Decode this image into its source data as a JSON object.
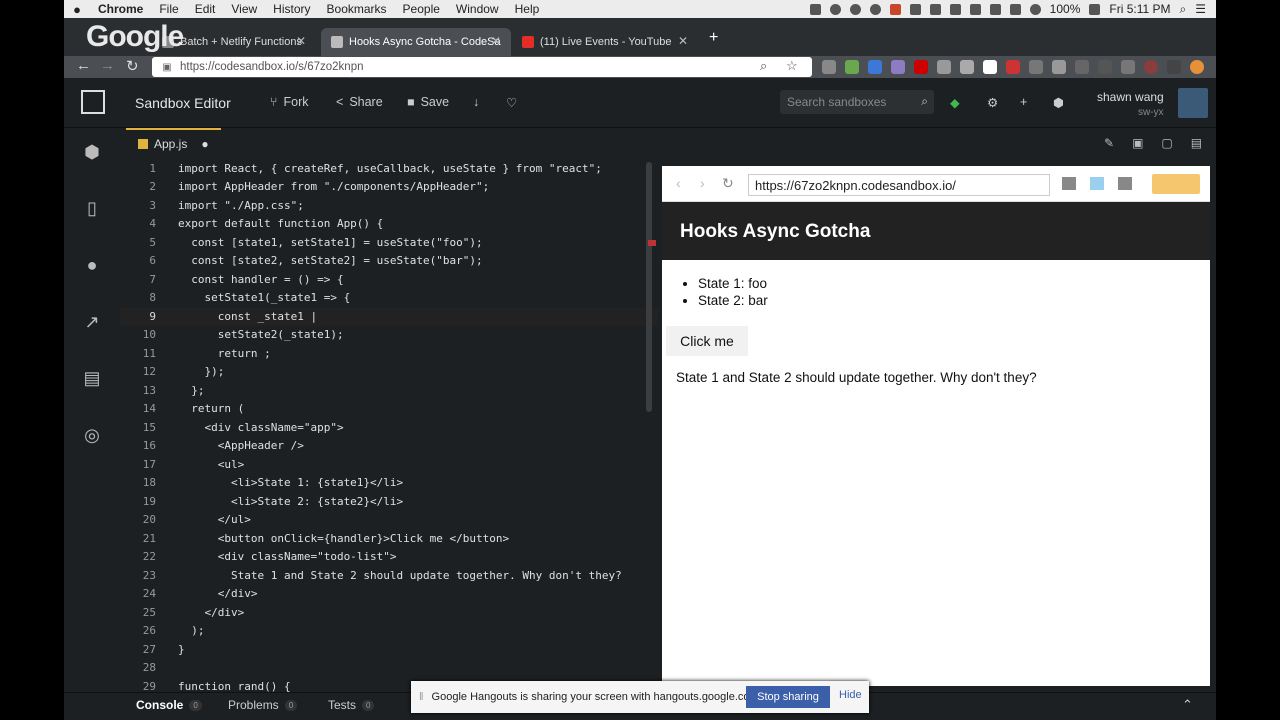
{
  "menubar": {
    "app": "Chrome",
    "items": [
      "File",
      "Edit",
      "View",
      "History",
      "Bookmarks",
      "People",
      "Window",
      "Help"
    ],
    "battery": "100%",
    "clock": "Fri 5:11 PM"
  },
  "overlay_logo": "Google",
  "tabs": [
    {
      "label": "Batch + Netlify Functions"
    },
    {
      "label": "Hooks Async Gotcha - CodeSa"
    },
    {
      "label": "(11) Live Events - YouTube"
    }
  ],
  "address_bar": {
    "url": "https://codesandbox.io/s/67zo2knpn"
  },
  "sandbox": {
    "title": "Sandbox Editor",
    "fork_label": "Fork",
    "share_label": "Share",
    "save_label": "Save",
    "search_placeholder": "Search sandboxes",
    "user_name": "shawn wang",
    "user_handle": "sw-yx"
  },
  "file_tab": {
    "name": "App.js",
    "modified_indicator": "●"
  },
  "editor": {
    "lines": [
      {
        "n": "1",
        "text": "import React, { createRef, useCallback, useState } from \"react\";"
      },
      {
        "n": "2",
        "text": "import AppHeader from \"./components/AppHeader\";"
      },
      {
        "n": "3",
        "text": "import \"./App.css\";"
      },
      {
        "n": "4",
        "text": "export default function App() {"
      },
      {
        "n": "5",
        "text": "  const [state1, setState1] = useState(\"foo\");"
      },
      {
        "n": "6",
        "text": "  const [state2, setState2] = useState(\"bar\");"
      },
      {
        "n": "7",
        "text": "  const handler = () => {"
      },
      {
        "n": "8",
        "text": "    setState1(_state1 => {"
      },
      {
        "n": "9",
        "text": "      const _state1 |"
      },
      {
        "n": "10",
        "text": "      setState2(_state1);"
      },
      {
        "n": "11",
        "text": "      return ;"
      },
      {
        "n": "12",
        "text": "    });"
      },
      {
        "n": "13",
        "text": "  };"
      },
      {
        "n": "14",
        "text": "  return ("
      },
      {
        "n": "15",
        "text": "    <div className=\"app\">"
      },
      {
        "n": "16",
        "text": "      <AppHeader />"
      },
      {
        "n": "17",
        "text": "      <ul>"
      },
      {
        "n": "18",
        "text": "        <li>State 1: {state1}</li>"
      },
      {
        "n": "19",
        "text": "        <li>State 2: {state2}</li>"
      },
      {
        "n": "20",
        "text": "      </ul>"
      },
      {
        "n": "21",
        "text": "      <button onClick={handler}>Click me </button>"
      },
      {
        "n": "22",
        "text": "      <div className=\"todo-list\">"
      },
      {
        "n": "23",
        "text": "        State 1 and State 2 should update together. Why don't they?"
      },
      {
        "n": "24",
        "text": "      </div>"
      },
      {
        "n": "25",
        "text": "    </div>"
      },
      {
        "n": "26",
        "text": "  );"
      },
      {
        "n": "27",
        "text": "}"
      },
      {
        "n": "28",
        "text": ""
      },
      {
        "n": "29",
        "text": "function rand() {"
      }
    ]
  },
  "preview": {
    "url": "https://67zo2knpn.codesandbox.io/",
    "header": "Hooks Async Gotcha",
    "list": [
      "State 1: foo",
      "State 2: bar"
    ],
    "button_label": "Click me",
    "text": "State 1 and State 2 should update together. Why don't they?"
  },
  "bottom": {
    "tabs": [
      {
        "label": "Console",
        "count": "0"
      },
      {
        "label": "Problems",
        "count": "0"
      },
      {
        "label": "Tests",
        "count": "0"
      }
    ]
  },
  "hangouts": {
    "message": "Google Hangouts is sharing your screen with hangouts.google.com.",
    "stop_label": "Stop sharing",
    "hide_label": "Hide"
  }
}
